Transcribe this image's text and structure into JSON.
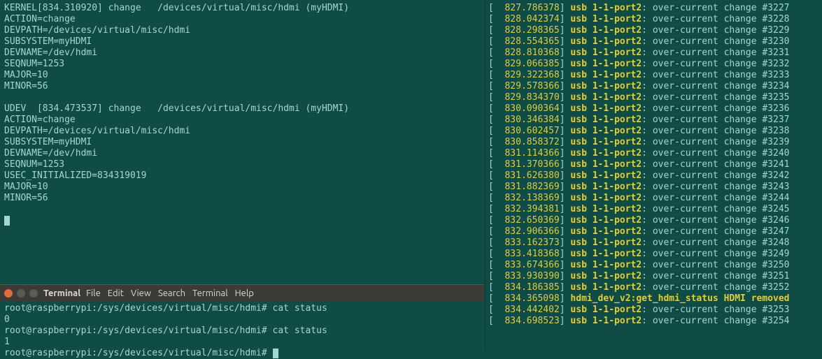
{
  "left_top": {
    "lines": [
      "KERNEL[834.310920] change   /devices/virtual/misc/hdmi (myHDMI)",
      "ACTION=change",
      "DEVPATH=/devices/virtual/misc/hdmi",
      "SUBSYSTEM=myHDMI",
      "DEVNAME=/dev/hdmi",
      "SEQNUM=1253",
      "MAJOR=10",
      "MINOR=56",
      "",
      "UDEV  [834.473537] change   /devices/virtual/misc/hdmi (myHDMI)",
      "ACTION=change",
      "DEVPATH=/devices/virtual/misc/hdmi",
      "SUBSYSTEM=myHDMI",
      "DEVNAME=/dev/hdmi",
      "SEQNUM=1253",
      "USEC_INITIALIZED=834319019",
      "MAJOR=10",
      "MINOR=56",
      ""
    ]
  },
  "window": {
    "title": "Terminal",
    "menu": [
      "File",
      "Edit",
      "View",
      "Search",
      "Terminal",
      "Help"
    ],
    "body_lines": [
      "root@raspberrypi:/sys/devices/virtual/misc/hdmi# cat status",
      "0",
      "root@raspberrypi:/sys/devices/virtual/misc/hdmi# cat status",
      "1",
      "root@raspberrypi:/sys/devices/virtual/misc/hdmi# "
    ]
  },
  "right": {
    "template_usb": {
      "device": "usb 1-1-port2",
      "msg": "over-current change #"
    },
    "hdmi_line": {
      "ts": "834.365098",
      "text": "hdmi_dev_v2:get_hdmi_status HDMI removed"
    },
    "rows": [
      {
        "ts": "827.786378",
        "n": 3227
      },
      {
        "ts": "828.042374",
        "n": 3228
      },
      {
        "ts": "828.298365",
        "n": 3229
      },
      {
        "ts": "828.554365",
        "n": 3230
      },
      {
        "ts": "828.810368",
        "n": 3231
      },
      {
        "ts": "829.066385",
        "n": 3232
      },
      {
        "ts": "829.322368",
        "n": 3233
      },
      {
        "ts": "829.578366",
        "n": 3234
      },
      {
        "ts": "829.834370",
        "n": 3235
      },
      {
        "ts": "830.090364",
        "n": 3236
      },
      {
        "ts": "830.346384",
        "n": 3237
      },
      {
        "ts": "830.602457",
        "n": 3238
      },
      {
        "ts": "830.858372",
        "n": 3239
      },
      {
        "ts": "831.114366",
        "n": 3240
      },
      {
        "ts": "831.370366",
        "n": 3241
      },
      {
        "ts": "831.626380",
        "n": 3242
      },
      {
        "ts": "831.882369",
        "n": 3243
      },
      {
        "ts": "832.138369",
        "n": 3244
      },
      {
        "ts": "832.394381",
        "n": 3245
      },
      {
        "ts": "832.650369",
        "n": 3246
      },
      {
        "ts": "832.906366",
        "n": 3247
      },
      {
        "ts": "833.162373",
        "n": 3248
      },
      {
        "ts": "833.418368",
        "n": 3249
      },
      {
        "ts": "833.674366",
        "n": 3250
      },
      {
        "ts": "833.930390",
        "n": 3251
      },
      {
        "ts": "834.186385",
        "n": 3252
      },
      {
        "ts": "834.365098",
        "hdmi": true
      },
      {
        "ts": "834.442402",
        "n": 3253
      },
      {
        "ts": "834.698523",
        "n": 3254
      }
    ]
  }
}
